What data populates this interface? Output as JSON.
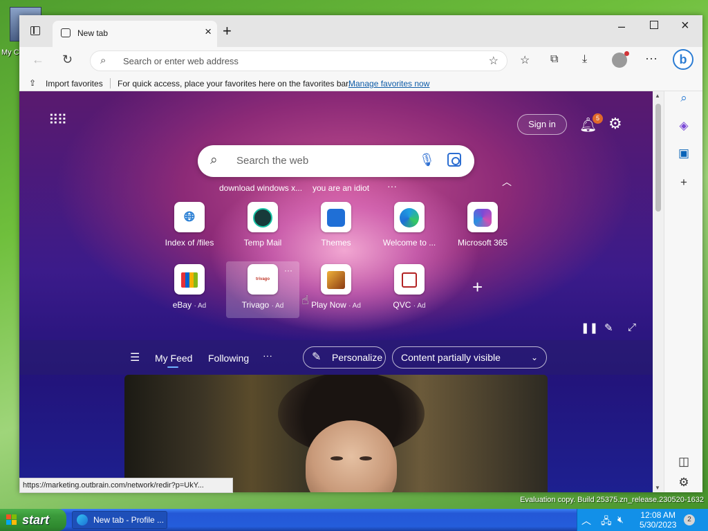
{
  "desktop": {
    "icon_label": "My C",
    "eval_line1": "",
    "eval_line2": "Evaluation copy. Build 25375.zn_release.230520-1632"
  },
  "browser": {
    "tab_title": "New tab",
    "address_placeholder": "Search or enter web address",
    "favorites_bar": {
      "import_label": "Import favorites",
      "hint_text": "For quick access, place your favorites here on the favorites bar.",
      "manage_link": "Manage favorites now"
    },
    "status_url": "https://marketing.outbrain.com/network/redir?p=UkY..."
  },
  "newtab": {
    "signin_label": "Sign in",
    "notification_count": "5",
    "search_placeholder": "Search the web",
    "trending": [
      "download windows x...",
      "you are an idiot"
    ],
    "tiles_row1": [
      {
        "label": "Index of /files",
        "icon": "globe-icon"
      },
      {
        "label": "Temp Mail",
        "icon": "tempmail-icon"
      },
      {
        "label": "Themes",
        "icon": "themes-icon"
      },
      {
        "label": "Welcome to ...",
        "icon": "edge-icon"
      },
      {
        "label": "Microsoft 365",
        "icon": "m365-icon"
      }
    ],
    "tiles_row2": [
      {
        "label": "eBay",
        "ad": "· Ad",
        "icon": "shopping-bag-icon"
      },
      {
        "label": "Trivago",
        "ad": "· Ad",
        "icon": "trivago-icon",
        "icon_text": "trivago"
      },
      {
        "label": "Play Now",
        "ad": "· Ad",
        "icon": "game-icon"
      },
      {
        "label": "QVC",
        "ad": "· Ad",
        "icon": "qvc-icon"
      }
    ],
    "feed": {
      "tabs": [
        "My Feed",
        "Following"
      ],
      "active_tab": "My Feed",
      "personalize_label": "Personalize",
      "content_select": "Content partially visible"
    }
  },
  "taskbar": {
    "start_label": "start",
    "task_label": "New tab - Profile ...",
    "time": "12:08 AM",
    "date": "5/30/2023",
    "notification_badge": "2"
  },
  "colors": {
    "taskbar": "#245ddb",
    "start": "#3b9a3b",
    "link": "#0c5aa6",
    "badge": "#e0692a"
  }
}
